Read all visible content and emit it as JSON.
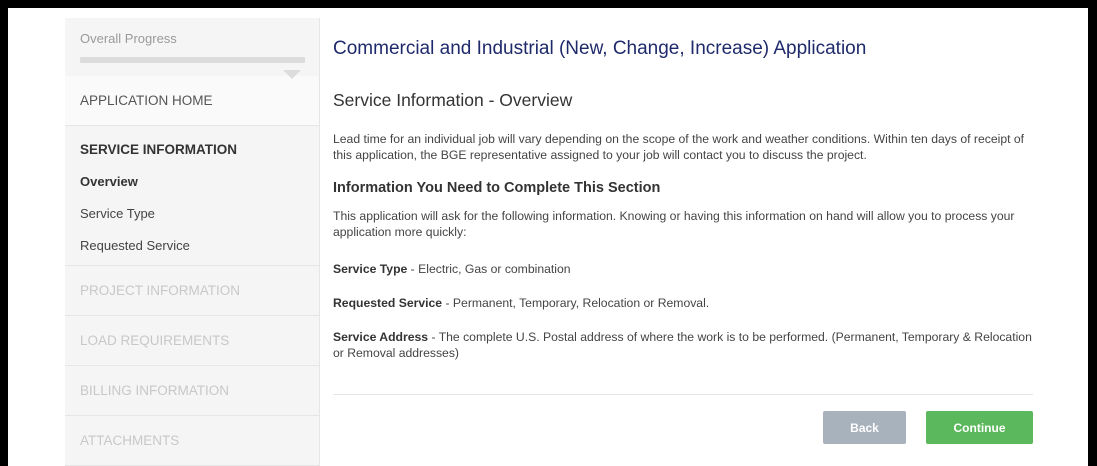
{
  "sidebar": {
    "progress_label": "Overall Progress",
    "home_label": "APPLICATION HOME",
    "current_section": {
      "title": "SERVICE INFORMATION",
      "items": [
        "Overview",
        "Service Type",
        "Requested Service"
      ]
    },
    "locked_sections": [
      "PROJECT INFORMATION",
      "LOAD REQUIREMENTS",
      "BILLING INFORMATION",
      "ATTACHMENTS"
    ]
  },
  "main": {
    "app_title": "Commercial and Industrial (New, Change, Increase) Application",
    "section_heading": "Service Information - Overview",
    "intro_text": "Lead time for an individual job will vary depending on the scope of the work and weather conditions. Within ten days of receipt of this application, the BGE representative assigned to your job will contact you to discuss the project.",
    "sub_heading": "Information You Need to Complete This Section",
    "info_text": "This application will ask for the following information. Knowing or having this information on hand will allow you to process your application more quickly:",
    "requirements": [
      {
        "label": "Service Type",
        "desc": " - Electric, Gas or combination"
      },
      {
        "label": "Requested Service",
        "desc": " - Permanent, Temporary, Relocation or Removal."
      },
      {
        "label": "Service Address",
        "desc": " - The complete U.S. Postal address of where the work is to be performed. (Permanent, Temporary & Relocation or Removal addresses)"
      }
    ],
    "back_label": "Back",
    "continue_label": "Continue"
  }
}
